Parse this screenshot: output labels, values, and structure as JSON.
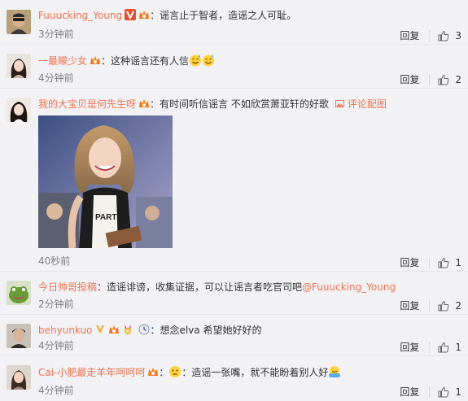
{
  "colors": {
    "username": "#eb7350",
    "text": "#333333",
    "time": "#808080",
    "background": "#f2f2f5"
  },
  "reply_label": "回复",
  "comments": [
    {
      "username": "Fuuucking_Young",
      "text": "：谣言止于智者，造谣之人可耻。",
      "time": "3分钟前",
      "likes": "3",
      "badges": [
        "vip-v-badge",
        "member-crown-badge"
      ],
      "avatar": "sunglasses-person-avatar"
    },
    {
      "username": "一最矇少女",
      "text": "：这种谣言还有人信",
      "emojis": [
        "sweat-smile-emoji",
        "sweat-smile-emoji"
      ],
      "time": "4分钟前",
      "likes": "2",
      "badges": [
        "member-crown-badge"
      ],
      "avatar": "girl-avatar"
    },
    {
      "username": "我的大宝贝是何先生呀",
      "text": "：有时间听信谣言 不如欣赏萧亚轩的好歌",
      "photo_link": "评论配图",
      "time": "40秒前",
      "likes": "1",
      "badges": [
        "member-crown-badge"
      ],
      "avatar": "woman-avatar",
      "image": "singer-photo"
    },
    {
      "username": "今日帅哥投稿",
      "text": "：造谣诽谤，收集证据，可以让谣言者吃官司吧",
      "mention": "@Fuuucking_Young",
      "time": "2分钟前",
      "likes": "2",
      "avatar": "frog-avatar"
    },
    {
      "username": "behyunkuo",
      "text": "：想念elva 希望她好好的",
      "time": "4分钟前",
      "likes": "1",
      "badges": [
        "vip-v-badge",
        "member-crown-badge",
        "medal-badge",
        "clock-badge"
      ],
      "avatar": "man-avatar"
    },
    {
      "username": "Cai-小肥最走羊年呵呵呵",
      "text": "：造谣一张嘴，就不能盼着别人好",
      "emojis": [
        "thinking-emoji",
        "hug-emoji"
      ],
      "time": "4分钟前",
      "likes": "1",
      "badges": [
        "member-crown-badge"
      ],
      "avatar": "lady-avatar"
    }
  ]
}
